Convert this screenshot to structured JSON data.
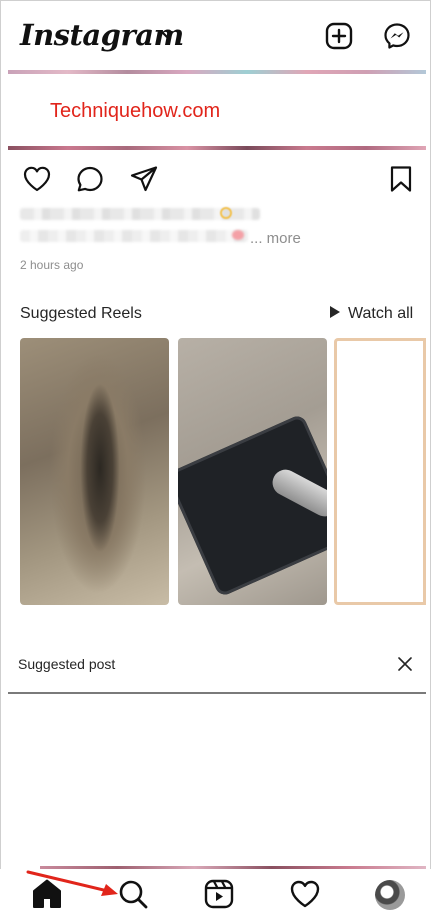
{
  "header": {
    "logo_text": "Instagram",
    "new_post_icon": "plus-square-icon",
    "messenger_icon": "messenger-icon"
  },
  "post": {
    "image_watermark": "Techniquehow.com",
    "caption_more": "... more",
    "timestamp": "2 hours ago"
  },
  "reels": {
    "title": "Suggested Reels",
    "watch_all": "Watch all"
  },
  "suggested_post": {
    "label": "Suggested post"
  },
  "bottom_nav": {
    "items": [
      "home-icon",
      "search-icon",
      "reels-icon",
      "activity-heart-icon",
      "profile-avatar"
    ],
    "active": "home"
  },
  "colors": {
    "watermark": "#e1251b",
    "annotation_arrow": "#e1251b"
  }
}
